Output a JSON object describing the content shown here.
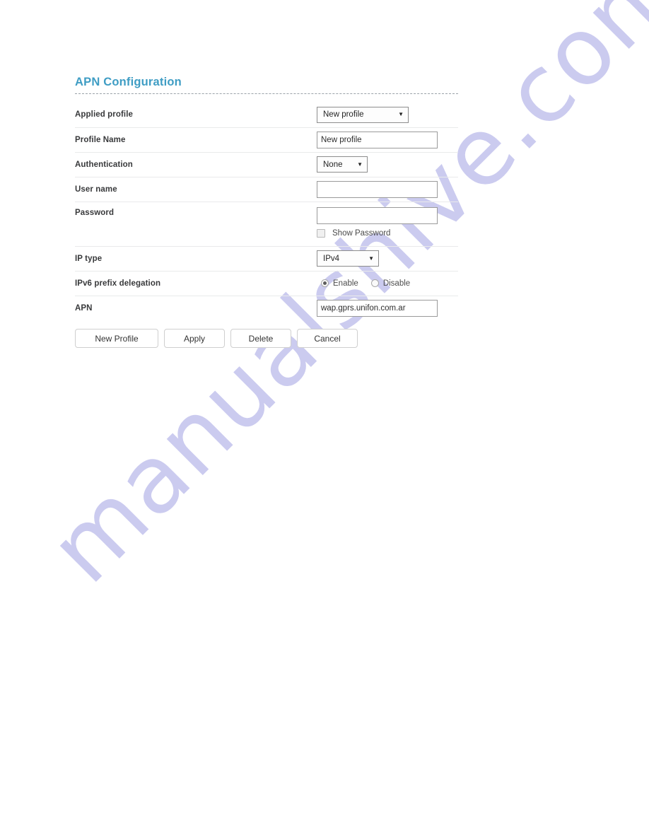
{
  "watermark": {
    "text": "manualshive.com",
    "color": "#c9c9ef"
  },
  "panel": {
    "title": "APN Configuration",
    "accent_color": "#3f9dc4"
  },
  "form": {
    "rows": [
      {
        "label": "Applied profile",
        "control": "select",
        "value": "New profile"
      },
      {
        "label": "Profile Name",
        "control": "text",
        "value": "New profile"
      },
      {
        "label": "Authentication",
        "control": "select",
        "value": "None"
      },
      {
        "label": "User name",
        "control": "text",
        "value": ""
      },
      {
        "label": "Password",
        "control": "password",
        "value": "",
        "show_password_label": "Show Password",
        "show_password_checked": false
      },
      {
        "label": "IP type",
        "control": "select",
        "value": "IPv4"
      },
      {
        "label": "IPv6 prefix delegation",
        "control": "radio",
        "options": [
          "Enable",
          "Disable"
        ],
        "selected": "Enable"
      },
      {
        "label": "APN",
        "control": "text",
        "value": "wap.gprs.unifon.com.ar"
      }
    ]
  },
  "buttons": [
    {
      "label": "New Profile"
    },
    {
      "label": "Apply"
    },
    {
      "label": "Delete"
    },
    {
      "label": "Cancel"
    }
  ],
  "icons": {
    "dropdown_arrow": "▼"
  }
}
